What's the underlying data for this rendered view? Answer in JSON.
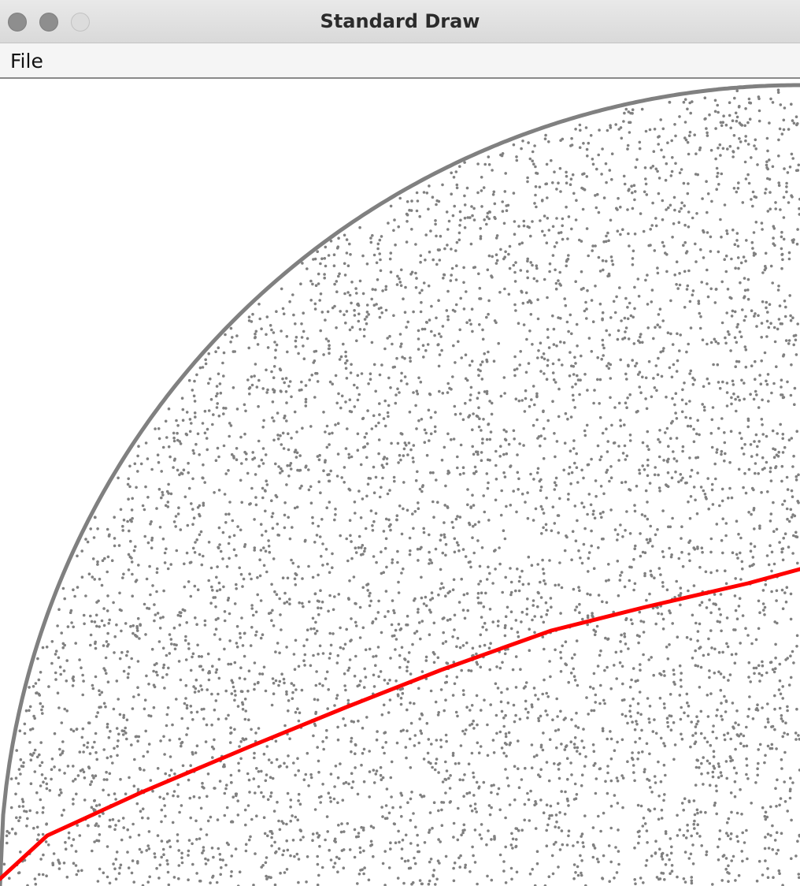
{
  "window": {
    "title": "Standard Draw"
  },
  "menu": {
    "items": [
      {
        "label": "File"
      }
    ]
  },
  "canvas": {
    "background_color": "#ffffff",
    "point_color": "#808080",
    "curve_color": "#ff0000"
  },
  "icons": {
    "close": "close-button-icon",
    "minimize": "minimize-button-icon",
    "zoom": "zoom-button-icon"
  }
}
